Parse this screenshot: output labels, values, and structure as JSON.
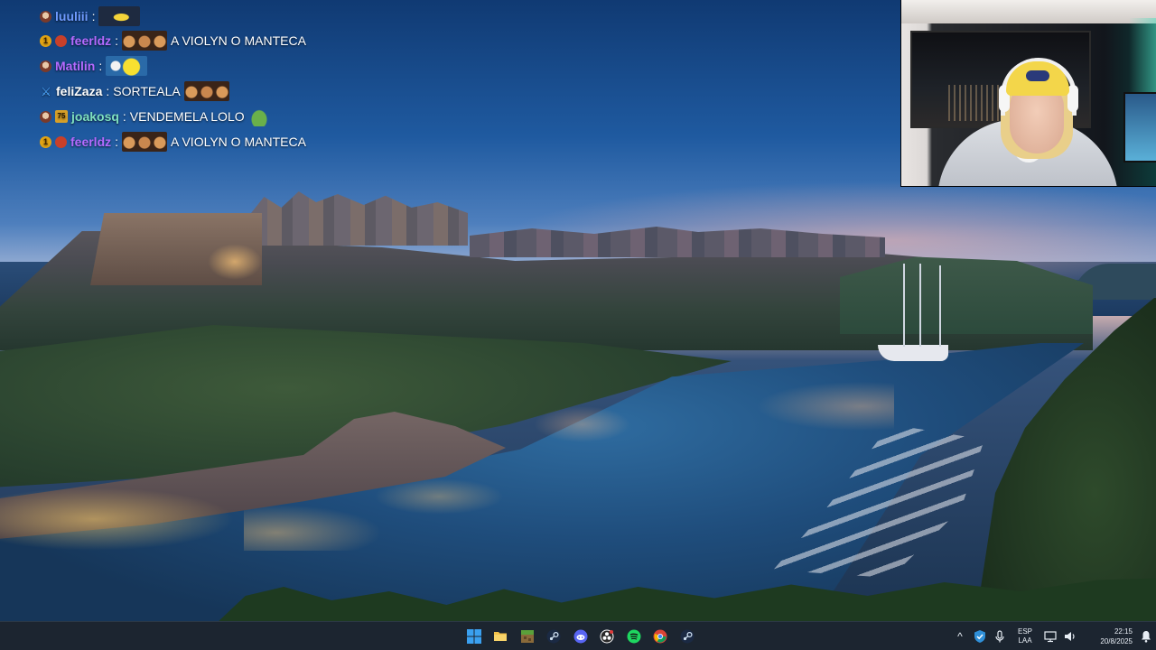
{
  "chat": {
    "messages": [
      {
        "user": "luuliii",
        "user_color": "#6f9bff",
        "text": "",
        "badges": [
          "mod"
        ],
        "emotes": [
          "emote-yellow"
        ]
      },
      {
        "user": "feerldz",
        "user_color": "#b46aff",
        "text": "A VIOLYN O MANTECA",
        "badges": [
          "sub",
          "red"
        ],
        "emotes": [
          "emote-faces"
        ]
      },
      {
        "user": "Matilin",
        "user_color": "#b46aff",
        "text": "",
        "badges": [
          "mod"
        ],
        "emotes": [
          "emote-yellow2"
        ]
      },
      {
        "user": "feliZaza",
        "user_color": "#ffffff",
        "text": "SORTEALA",
        "badges": [
          "sword"
        ],
        "emotes": [
          "emote-faces"
        ]
      },
      {
        "user": "joakosq",
        "user_color": "#7ee0c0",
        "text": "VENDEMELA LOLO",
        "badges": [
          "mod",
          "box"
        ],
        "emotes": [
          "emote-frog"
        ]
      },
      {
        "user": "feerldz",
        "user_color": "#b46aff",
        "text": "A VIOLYN O MANTECA",
        "badges": [
          "sub",
          "red"
        ],
        "emotes": [
          "emote-faces"
        ]
      }
    ],
    "badge_text": {
      "sub": "1",
      "box": "75"
    }
  },
  "taskbar": {
    "apps": [
      {
        "name": "start",
        "icon": "windows-logo-icon"
      },
      {
        "name": "file-explorer",
        "icon": "folder-icon"
      },
      {
        "name": "minecraft",
        "icon": "minecraft-icon"
      },
      {
        "name": "steam",
        "icon": "steam-icon"
      },
      {
        "name": "discord",
        "icon": "discord-icon"
      },
      {
        "name": "obs",
        "icon": "obs-icon"
      },
      {
        "name": "spotify",
        "icon": "spotify-icon"
      },
      {
        "name": "chrome",
        "icon": "chrome-icon"
      },
      {
        "name": "steam-2",
        "icon": "steam-icon"
      }
    ],
    "tray": {
      "lang_top": "ESP",
      "lang_bottom": "LAA",
      "time": "22:15",
      "date": "20/8/2025",
      "chevron": "^"
    }
  },
  "colors": {
    "taskbar_bg": "#1c2530",
    "accent_blue": "#4ea8ff"
  }
}
